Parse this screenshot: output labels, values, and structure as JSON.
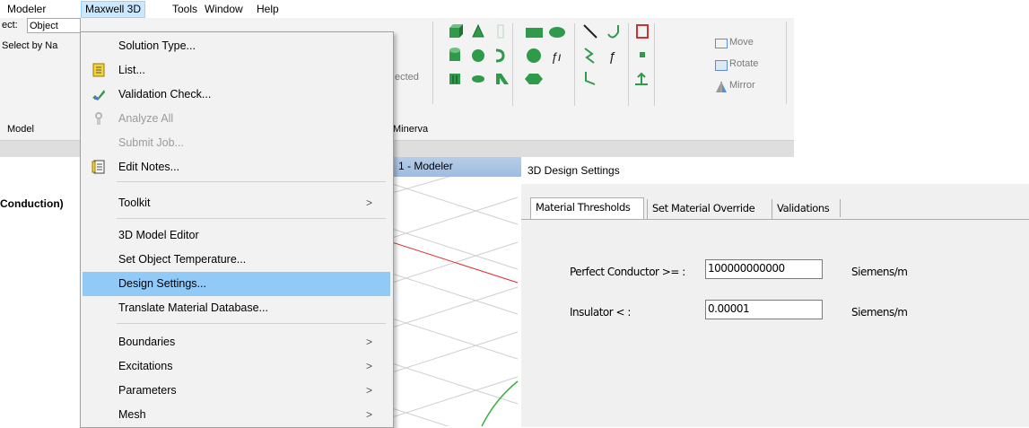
{
  "menubar": {
    "items": [
      "Modeler",
      "Maxwell 3D",
      "Tools",
      "Window",
      "Help"
    ]
  },
  "ribbon": {
    "select_label": "ect:",
    "select_value": "Object",
    "select_by_name": "Select by Na",
    "selected_text": "ected",
    "move": "Move",
    "rotate": "Rotate",
    "mirror": "Mirror",
    "tab_model": "Model",
    "tab_minerva": "Minerva"
  },
  "left_panel": {
    "title": "Conduction)"
  },
  "viewport": {
    "title": "1 - Modeler"
  },
  "maxwell_menu": {
    "items": [
      {
        "label": "Solution Type...",
        "disabled": false,
        "submenu": false
      },
      {
        "label": "List...",
        "disabled": false,
        "submenu": false,
        "icon": "list-icon"
      },
      {
        "label": "Validation Check...",
        "disabled": false,
        "submenu": false,
        "icon": "validation-check-icon"
      },
      {
        "label": "Analyze All",
        "disabled": true,
        "submenu": false,
        "icon": "analyze-all-icon"
      },
      {
        "label": "Submit Job...",
        "disabled": true,
        "submenu": false
      },
      {
        "label": "Edit Notes...",
        "disabled": false,
        "submenu": false,
        "icon": "edit-notes-icon"
      },
      {
        "label": "Toolkit",
        "disabled": false,
        "submenu": true
      },
      {
        "label": "3D Model Editor",
        "disabled": false,
        "submenu": false
      },
      {
        "label": "Set Object Temperature...",
        "disabled": false,
        "submenu": false
      },
      {
        "label": "Design Settings...",
        "disabled": false,
        "submenu": false,
        "highlighted": true
      },
      {
        "label": "Translate Material Database...",
        "disabled": false,
        "submenu": false
      },
      {
        "label": "Boundaries",
        "disabled": false,
        "submenu": true
      },
      {
        "label": "Excitations",
        "disabled": false,
        "submenu": true
      },
      {
        "label": "Parameters",
        "disabled": false,
        "submenu": true
      },
      {
        "label": "Mesh",
        "disabled": false,
        "submenu": true
      }
    ],
    "submenu_arrow": ">"
  },
  "dialog": {
    "title": "3D Design Settings",
    "tabs": [
      "Material Thresholds",
      "Set Material Override",
      "Validations"
    ],
    "active_tab": "Material Thresholds",
    "perfect_conductor_label": "Perfect Conductor >= :",
    "perfect_conductor_value": "100000000000",
    "perfect_conductor_unit": "Siemens/m",
    "insulator_label": "Insulator < :",
    "insulator_value": "0.00001",
    "insulator_unit": "Siemens/m"
  },
  "colors": {
    "menu_highlight": "#91c9f7",
    "menubar_active": "#cce8ff",
    "shape_green": "#2e9a4a",
    "wireframe_green": "#3cb043",
    "axis_red": "#d93030"
  }
}
